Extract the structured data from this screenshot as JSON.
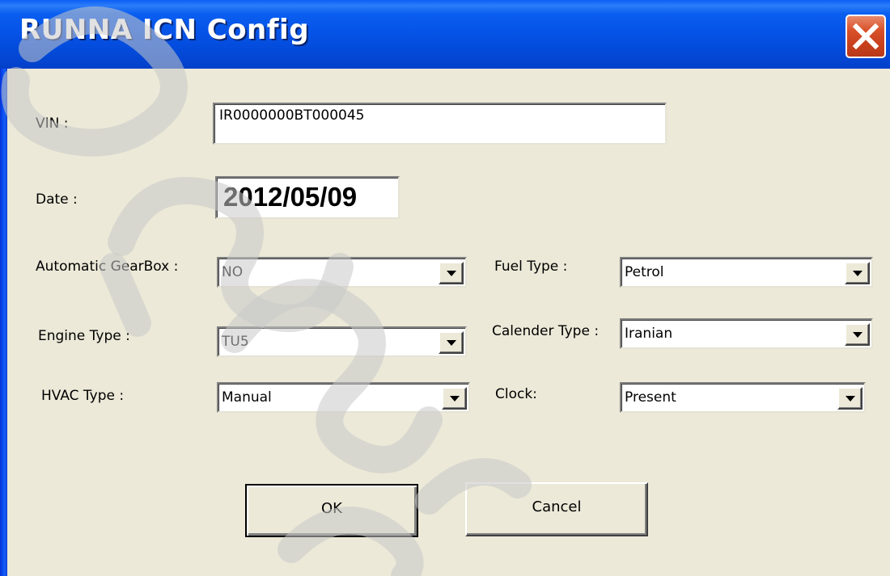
{
  "window": {
    "title": "RUNNA ICN Config"
  },
  "icons": {
    "close": "close-icon",
    "dropdown": "chevron-down-icon"
  },
  "colors": {
    "titlebar": "#0552e6",
    "dialog_background": "#ece9d8",
    "close_button": "#d9512a",
    "watermark": "#c8c8c8"
  },
  "form": {
    "vin": {
      "label": "VIN :",
      "value": "IR0000000BT000045"
    },
    "date": {
      "label": "Date :",
      "value": "2012/05/09"
    },
    "automatic_gearbox": {
      "label": "Automatic GearBox :",
      "value": "NO"
    },
    "engine_type": {
      "label": "Engine Type :",
      "value": "TU5"
    },
    "hvac_type": {
      "label": "HVAC Type :",
      "value": "Manual"
    },
    "fuel_type": {
      "label": "Fuel Type :",
      "value": "Petrol"
    },
    "calender_type": {
      "label": "Calender Type :",
      "value": "Iranian"
    },
    "clock": {
      "label": "Clock:",
      "value": "Present"
    }
  },
  "buttons": {
    "ok": "OK",
    "cancel": "Cancel"
  }
}
